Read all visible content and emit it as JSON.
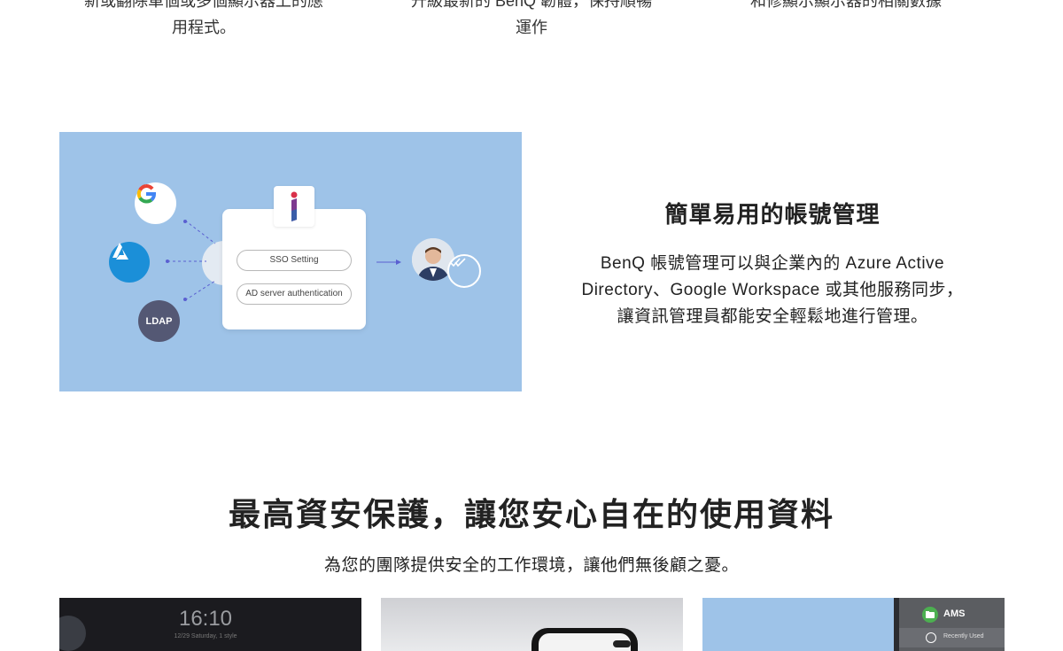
{
  "top_columns": [
    {
      "lines": [
        "新或翻除單個或多個顯示器上的應",
        "用程式。"
      ]
    },
    {
      "lines": [
        "升級最新的 BenQ 韌體，保持順暢",
        "運作"
      ]
    },
    {
      "lines": [
        "和修顯示顯示器的相關數據",
        ""
      ]
    }
  ],
  "illustration": {
    "providers": [
      {
        "name": "google",
        "label": "G"
      },
      {
        "name": "azure",
        "label": ""
      },
      {
        "name": "ldap",
        "label": "LDAP"
      }
    ],
    "sso_setting_label": "SSO Setting",
    "ad_auth_label": "AD server authentication",
    "colors": {
      "background": "#9ec3e8",
      "azure": "#1b8fd8",
      "ldap": "#545874",
      "connector": "#5a5fd1"
    }
  },
  "feature": {
    "title": "簡單易用的帳號管理",
    "desc_lines": [
      "BenQ 帳號管理可以與企業內的 Azure Active",
      "Directory、Google Workspace 或其他服務同步，",
      "讓資訊管理員都能安全輕鬆地進行管理。"
    ]
  },
  "section": {
    "title": "最高資安保護，讓您安心自在的使用資料",
    "subtitle": "為您的團隊提供安全的工作環境，讓他們無後顧之憂。"
  },
  "cards": {
    "card1": {
      "clock": "16:10",
      "date": "12/29 Saturday, 1 style"
    },
    "card3": {
      "app_name": "AMS",
      "recently_used": "Recently Used"
    }
  }
}
